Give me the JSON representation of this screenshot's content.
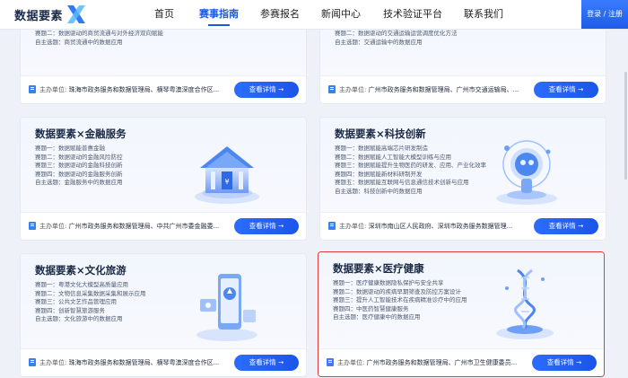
{
  "nav": {
    "logo_text": "数据要素",
    "items": [
      {
        "label": "首页"
      },
      {
        "label": "赛事指南"
      },
      {
        "label": "参赛报名"
      },
      {
        "label": "新闻中心"
      },
      {
        "label": "技术验证平台"
      },
      {
        "label": "联系我们"
      }
    ],
    "active_index": 1,
    "login_label": "登录 / 注册"
  },
  "labels": {
    "organizer": "主办单位:",
    "detail": "查看详情 →"
  },
  "cards": [
    {
      "title": "",
      "tracks": [
        "赛题二：数据驱动的商贸流通与对外经济双向赋能",
        "自主选题：商贸流通中的数据应用"
      ],
      "organizer": "珠海市政务服务和数据管理局、横琴粤澳深度合作区..."
    },
    {
      "title": "",
      "tracks": [
        "赛题二：数据驱动的交通运输运营调度优化方法",
        "自主选题：交通运输中的数据应用"
      ],
      "organizer": "广州市政务服务和数据管理局、广州市交通运输局、..."
    },
    {
      "title": "数据要素×金融服务",
      "tracks": [
        "赛题一：数据赋能普惠金融",
        "赛题二：数据驱动的金融风险防控",
        "赛题三：数据驱动的金融科技创新",
        "赛题四：数据驱动的金融服务创新",
        "自主选题：金融服务中的数据应用"
      ],
      "organizer": "广州市政务服务和数据管理局、中共广州市委金融委..."
    },
    {
      "title": "数据要素×科技创新",
      "tracks": [
        "赛题一：数据赋能高端芯片研发制造",
        "赛题二：数据赋能人工智能大模型训练与应用",
        "赛题三：数据赋能提升生物医药的研发、应用、产业化效率",
        "赛题四：数据赋能新材料研制开发",
        "赛题五：数据赋能互联网与信息通信技术创新与应用",
        "自主选题：科技创新中的数据应用"
      ],
      "organizer": "深圳市南山区人民政府、深圳市政务服务数据管理..."
    },
    {
      "title": "数据要素×文化旅游",
      "tracks": [
        "赛题一：粤港文化大模型高质量应用",
        "赛题二：文物信息采集数据采集和展示应用",
        "赛题三：公共文艺作品管理应用",
        "赛题四：创新智慧旅游服务",
        "自主选题：文化旅游中的数据应用"
      ],
      "organizer": "珠海市政务服务和数据管理局、横琴粤澳深度合作区..."
    },
    {
      "title": "数据要素×医疗健康",
      "tracks": [
        "赛题一：医疗健康数据隐私保护与安全共享",
        "赛题二：数据驱动的疾病早期筛查及防控方案设计",
        "赛题三：提升人工智能技术在疾病精准诊疗中的应用",
        "赛题四：中医药智慧健康服务",
        "自主选题：医疗健康中的数据应用"
      ],
      "organizer": "广州市政务服务和数据管理局、广州市卫生健康委员..."
    }
  ]
}
